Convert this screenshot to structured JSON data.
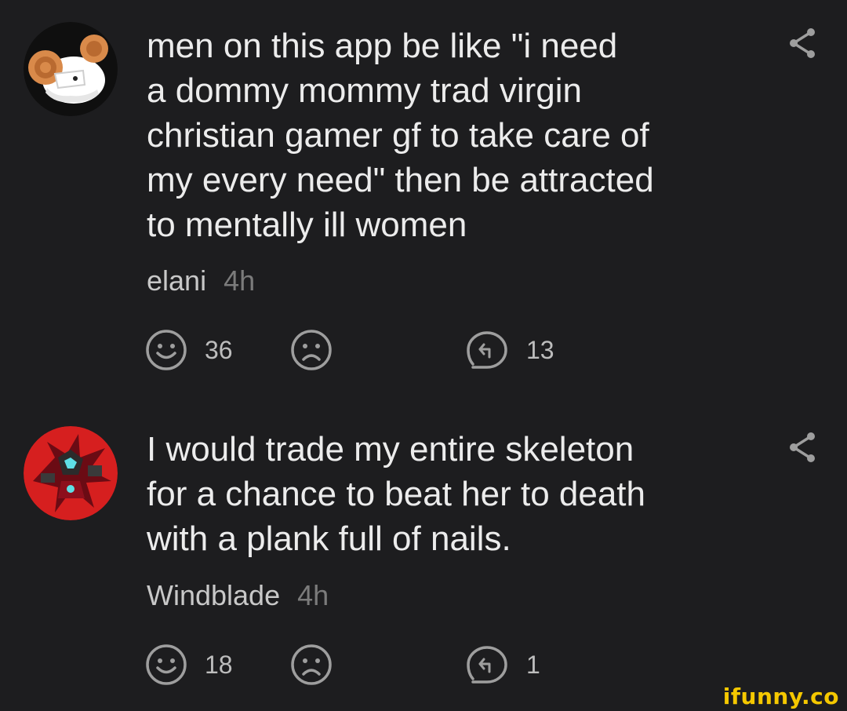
{
  "comments": [
    {
      "avatar_icon": "ram-character-avatar",
      "text": "men on this app be like \"i need\na dommy mommy trad virgin\nchristian gamer gf to take care of\nmy every need\" then be attracted\nto mentally ill women",
      "username": "elani",
      "time": "4h",
      "smiles": "36",
      "replies": "13"
    },
    {
      "avatar_icon": "red-robot-character-avatar",
      "text": "I would trade my entire skeleton\nfor a chance to beat her to death\nwith a plank full of nails.",
      "username": "Windblade",
      "time": "4h",
      "smiles": "18",
      "replies": "1"
    }
  ],
  "colors": {
    "background": "#1d1d1f",
    "text": "#ececec",
    "muted": "#7b7b7b",
    "icon": "#9e9e9e",
    "watermark": "#f5c800"
  },
  "watermark": "ifunny.co"
}
